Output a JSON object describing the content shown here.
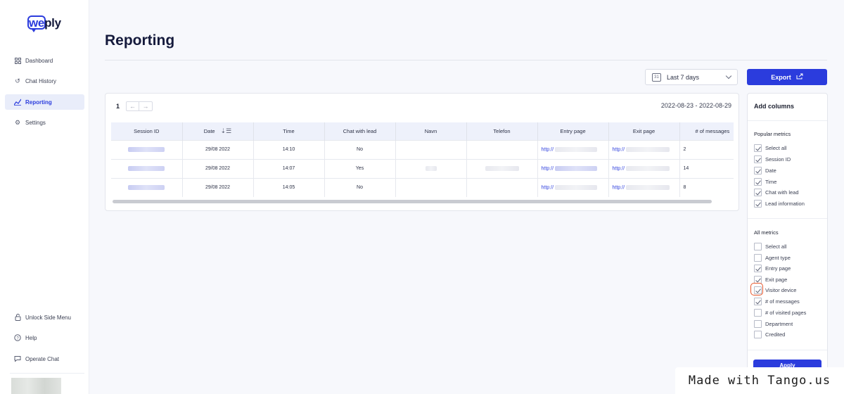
{
  "brand": {
    "logo_text_we": "we",
    "logo_text_ply": "ply"
  },
  "sidebar": {
    "items": [
      {
        "label": "Dashboard",
        "icon": "grid-icon"
      },
      {
        "label": "Chat History",
        "icon": "history-icon"
      },
      {
        "label": "Reporting",
        "icon": "chart-icon",
        "active": true
      },
      {
        "label": "Settings",
        "icon": "gear-icon"
      }
    ],
    "bottom_items": [
      {
        "label": "Unlock Side Menu",
        "icon": "lock-icon"
      },
      {
        "label": "Help",
        "icon": "help-icon"
      },
      {
        "label": "Operate Chat",
        "icon": "chat-icon"
      }
    ]
  },
  "page": {
    "title": "Reporting"
  },
  "toolbar": {
    "range_label": "Last 7 days",
    "calendar_icon_text": "31",
    "export_label": "Export"
  },
  "table": {
    "page_number": "1",
    "prev_arrow": "←",
    "next_arrow": "→",
    "date_range": "2022-08-23 - 2022-08-29",
    "columns": [
      "Session ID",
      "Date",
      "Time",
      "Chat with lead",
      "Navn",
      "Telefon",
      "Entry page",
      "Exit page",
      "# of messages"
    ],
    "rows": [
      {
        "date": "29/08 2022",
        "time": "14:10",
        "chat_with_lead": "No",
        "entry": "http://",
        "exit": "http://",
        "messages": "2"
      },
      {
        "date": "29/08 2022",
        "time": "14:07",
        "chat_with_lead": "Yes",
        "entry": "http://",
        "exit": "http://",
        "messages": "14"
      },
      {
        "date": "29/08 2022",
        "time": "14:05",
        "chat_with_lead": "No",
        "entry": "http://",
        "exit": "http://",
        "messages": "8"
      }
    ]
  },
  "columns_panel": {
    "title": "Add columns",
    "popular_title": "Popular metrics",
    "popular": [
      {
        "label": "Select all",
        "checked": true
      },
      {
        "label": "Session ID",
        "checked": true
      },
      {
        "label": "Date",
        "checked": true
      },
      {
        "label": "Time",
        "checked": true
      },
      {
        "label": "Chat with lead",
        "checked": true
      },
      {
        "label": "Lead information",
        "checked": true
      }
    ],
    "all_title": "All metrics",
    "all": [
      {
        "label": "Select all",
        "checked": false
      },
      {
        "label": "Agent type",
        "checked": false
      },
      {
        "label": "Entry page",
        "checked": true
      },
      {
        "label": "Exit page",
        "checked": true
      },
      {
        "label": "Visitor device",
        "checked": true
      },
      {
        "label": "# of messages",
        "checked": true
      },
      {
        "label": "# of visited pages",
        "checked": false
      },
      {
        "label": "Department",
        "checked": false
      },
      {
        "label": "Credited",
        "checked": false
      }
    ],
    "apply_label": "Apply"
  },
  "watermark": "Made with Tango.us",
  "colors": {
    "accent": "#2b3cdd",
    "highlight": "#e8582c"
  }
}
